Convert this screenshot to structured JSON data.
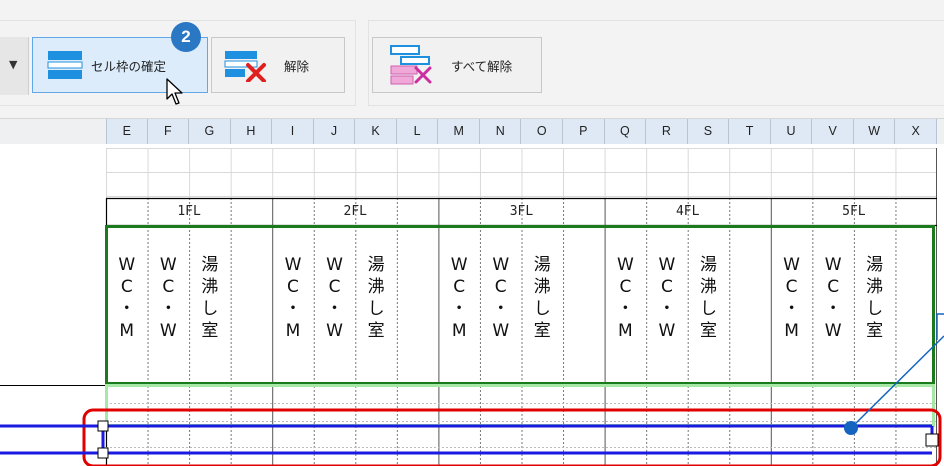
{
  "ribbon": {
    "dropdown_arrow": "▼",
    "buttons": {
      "confirm": {
        "label": "セル枠の確定",
        "icon": "cell-frame-confirm-icon"
      },
      "release": {
        "label": "解除",
        "icon": "cell-frame-release-icon"
      },
      "release_all": {
        "label": "すべて解除",
        "icon": "cell-frame-release-all-icon"
      }
    },
    "step_badge": "2"
  },
  "columns": [
    "E",
    "F",
    "G",
    "H",
    "I",
    "J",
    "K",
    "L",
    "M",
    "N",
    "O",
    "P",
    "Q",
    "R",
    "S",
    "T",
    "U",
    "V",
    "W",
    "X"
  ],
  "floors": [
    "1FL",
    "2FL",
    "3FL",
    "4FL",
    "5FL"
  ],
  "room_labels": [
    [
      "W",
      "C",
      "・",
      "M"
    ],
    [
      "W",
      "C",
      "・",
      "W"
    ],
    [
      "湯",
      "沸",
      "し",
      "室"
    ]
  ],
  "colors": {
    "accent_blue": "#2a77c4",
    "selection_green": "#1b7a1b",
    "light_green": "#a6e8a6",
    "highlight_red": "#e00000",
    "frame_blue": "#1a1ae0",
    "callout_blue": "#1565c0"
  }
}
